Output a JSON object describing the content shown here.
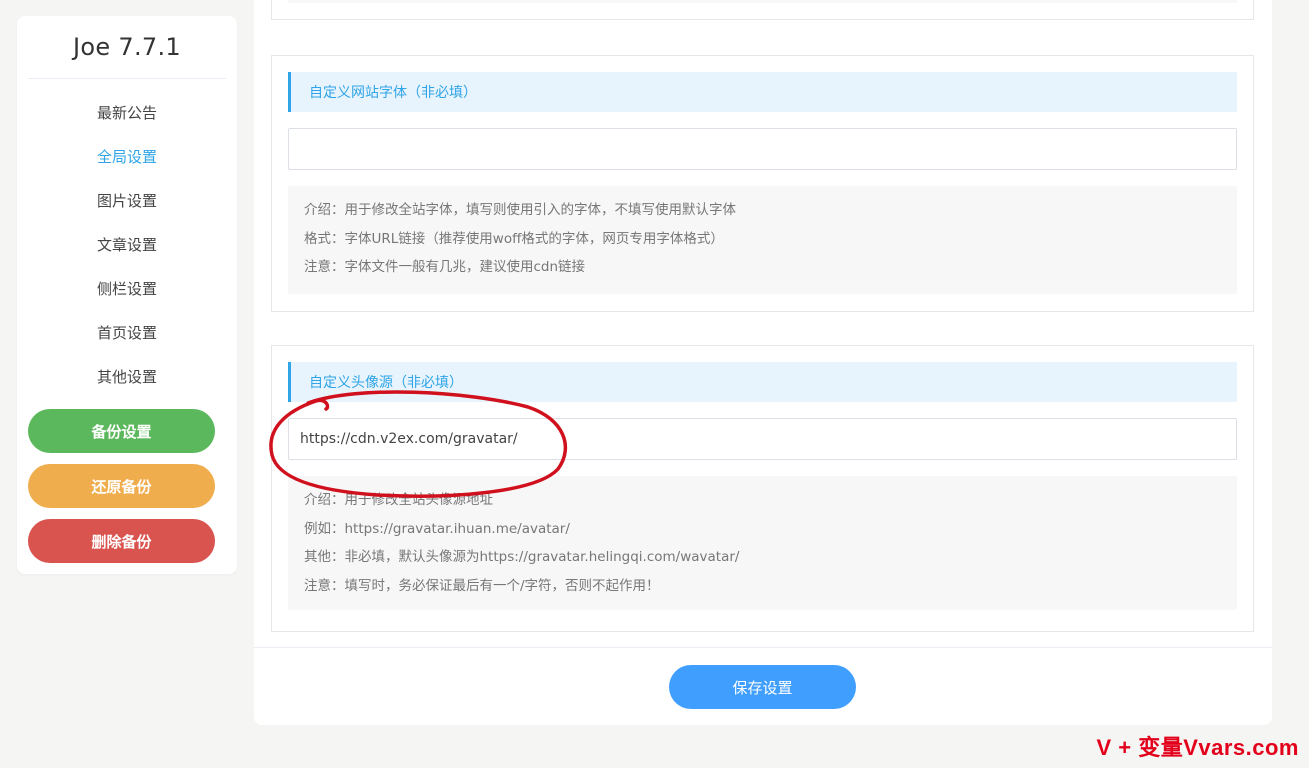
{
  "sidebar": {
    "title": "Joe 7.7.1",
    "items": [
      {
        "label": "最新公告",
        "active": false
      },
      {
        "label": "全局设置",
        "active": true
      },
      {
        "label": "图片设置",
        "active": false
      },
      {
        "label": "文章设置",
        "active": false
      },
      {
        "label": "侧栏设置",
        "active": false
      },
      {
        "label": "首页设置",
        "active": false
      },
      {
        "label": "其他设置",
        "active": false
      }
    ],
    "buttons": {
      "backup": "备份设置",
      "restore": "还原备份",
      "delete": "删除备份"
    }
  },
  "main": {
    "font_card": {
      "header": "自定义网站字体（非必填）",
      "value": "",
      "desc": [
        "介绍：用于修改全站字体，填写则使用引入的字体，不填写使用默认字体",
        "格式：字体URL链接（推荐使用woff格式的字体，网页专用字体格式）",
        "注意：字体文件一般有几兆，建议使用cdn链接"
      ]
    },
    "avatar_card": {
      "header": "自定义头像源（非必填）",
      "value": "https://cdn.v2ex.com/gravatar/",
      "desc": [
        "介绍：用于修改全站头像源地址",
        "例如：https://gravatar.ihuan.me/avatar/",
        "其他：非必填，默认头像源为https://gravatar.helingqi.com/wavatar/",
        "注意：填写时，务必保证最后有一个/字符，否则不起作用！"
      ]
    },
    "save_label": "保存设置"
  },
  "watermark": "V + 变量Vvars.com",
  "colors": {
    "accent": "#2fa4e7",
    "backup": "#5cb85c",
    "restore": "#f0ad4e",
    "delete": "#d9534f",
    "save": "#409eff",
    "annotation": "#d0101c"
  }
}
